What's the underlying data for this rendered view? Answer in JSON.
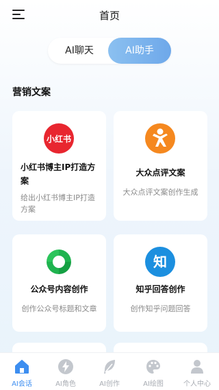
{
  "header": {
    "title": "首页"
  },
  "segment": {
    "options": [
      "AI聊天",
      "AI助手"
    ],
    "selected": "AI助手"
  },
  "section": {
    "title": "营销文案"
  },
  "cards": [
    {
      "title": "小红书博主IP打造方案",
      "desc": "给出小红书博主IP打造方案",
      "icon": "xiaohongshu-logo",
      "icon_text": "小红书",
      "color": "#e8262f"
    },
    {
      "title": "大众点评文案",
      "desc": "大众点评文案创作生成",
      "icon": "dianping-logo",
      "color": "#f5881f"
    },
    {
      "title": "公众号内容创作",
      "desc": "创作公众号标题和文章",
      "icon": "wechat-official-account-logo",
      "color": "#19b14a"
    },
    {
      "title": "知乎回答创作",
      "desc": "创作知乎问题回答",
      "icon": "zhihu-logo",
      "icon_text": "知",
      "color": "#1c8fdf"
    }
  ],
  "tabbar": {
    "active": "AI会话",
    "items": [
      {
        "label": "AI会话",
        "icon": "home-icon"
      },
      {
        "label": "AI角色",
        "icon": "lightning-icon"
      },
      {
        "label": "AI创作",
        "icon": "feather-icon"
      },
      {
        "label": "AI绘图",
        "icon": "palette-icon"
      },
      {
        "label": "个人中心",
        "icon": "user-icon"
      }
    ]
  },
  "colors": {
    "accent": "#3d8ef0",
    "segment_active": "#7db3ee",
    "muted_text": "#8a8a8a"
  }
}
